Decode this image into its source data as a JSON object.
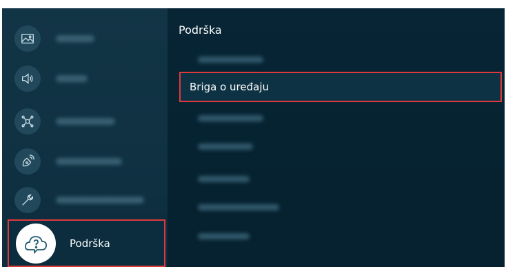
{
  "left_menu": {
    "items": [
      {
        "icon": "picture-icon"
      },
      {
        "icon": "sound-icon"
      },
      {
        "icon": "network-icon"
      },
      {
        "icon": "broadcasting-icon"
      },
      {
        "icon": "general-icon"
      }
    ],
    "selected": {
      "label": "Podrška",
      "icon": "support-cloud-icon"
    }
  },
  "submenu": {
    "title": "Podrška",
    "selected_item": "Briga o uređaju"
  },
  "colors": {
    "highlight": "#e0393d",
    "background": "#0a2a3a",
    "text": "#ffffff"
  }
}
